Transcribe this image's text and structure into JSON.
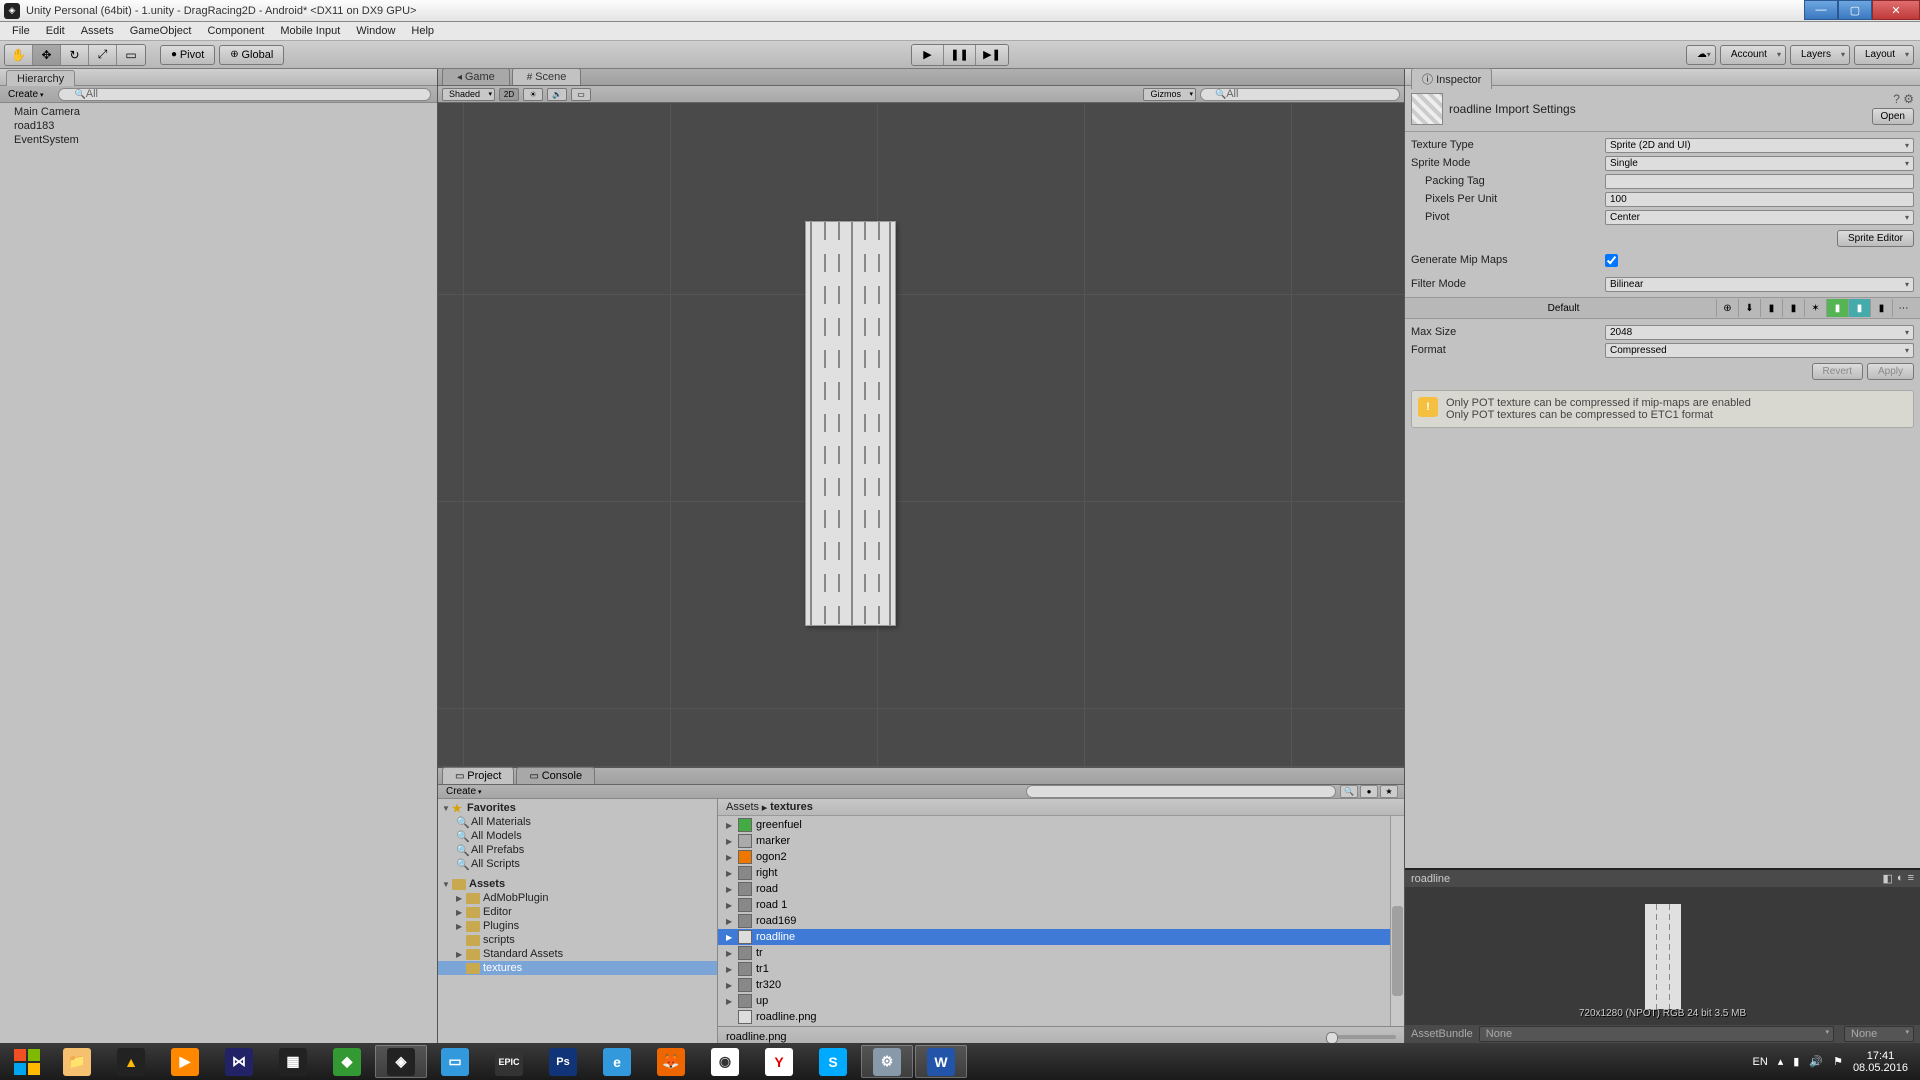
{
  "title": "Unity Personal (64bit) - 1.unity - DragRacing2D - Android* <DX11 on DX9 GPU>",
  "menu": [
    "File",
    "Edit",
    "Assets",
    "GameObject",
    "Component",
    "Mobile Input",
    "Window",
    "Help"
  ],
  "toolbar": {
    "pivot": "Pivot",
    "global": "Global",
    "account": "Account",
    "layers": "Layers",
    "layout": "Layout"
  },
  "hierarchy": {
    "tab": "Hierarchy",
    "create": "Create",
    "search_ph": "All",
    "items": [
      "Main Camera",
      "road183",
      "EventSystem"
    ]
  },
  "scene": {
    "tabs": [
      "Game",
      "Scene"
    ],
    "shaded": "Shaded",
    "mode2d": "2D",
    "gizmos": "Gizmos",
    "search_ph": "All"
  },
  "project": {
    "tab_project": "Project",
    "tab_console": "Console",
    "create": "Create",
    "favorites": "Favorites",
    "fav_items": [
      "All Materials",
      "All Models",
      "All Prefabs",
      "All Scripts"
    ],
    "assets": "Assets",
    "asset_folders": [
      "AdMobPlugin",
      "Editor",
      "Plugins",
      "scripts",
      "Standard Assets",
      "textures"
    ],
    "crumb_assets": "Assets",
    "crumb_sep": "▸",
    "crumb_textures": "textures",
    "list": [
      "greenfuel",
      "marker",
      "ogon2",
      "right",
      "road",
      "road 1",
      "road169",
      "roadline",
      "tr",
      "tr1",
      "tr320",
      "up",
      "roadline.png"
    ],
    "selected": "roadline",
    "footer": "roadline.png"
  },
  "inspector": {
    "tab": "Inspector",
    "title": "roadline Import Settings",
    "open": "Open",
    "rows": {
      "texture_type_l": "Texture Type",
      "texture_type_v": "Sprite (2D and UI)",
      "sprite_mode_l": "Sprite Mode",
      "sprite_mode_v": "Single",
      "packing_tag_l": "Packing Tag",
      "packing_tag_v": "",
      "ppu_l": "Pixels Per Unit",
      "ppu_v": "100",
      "pivot_l": "Pivot",
      "pivot_v": "Center",
      "sprite_editor": "Sprite Editor",
      "genmip_l": "Generate Mip Maps",
      "filter_l": "Filter Mode",
      "filter_v": "Bilinear",
      "default": "Default",
      "maxsize_l": "Max Size",
      "maxsize_v": "2048",
      "format_l": "Format",
      "format_v": "Compressed",
      "revert": "Revert",
      "apply": "Apply"
    },
    "warning_l1": "Only POT texture can be compressed if mip-maps are enabled",
    "warning_l2": "Only POT textures can be compressed to ETC1 format"
  },
  "preview": {
    "name": "roadline",
    "info": "720x1280 (NPOT)  RGB 24 bit   3.5 MB",
    "assetbundle_l": "AssetBundle",
    "none": "None"
  },
  "tray": {
    "lang": "EN",
    "time": "17:41",
    "date": "08.05.2016"
  }
}
